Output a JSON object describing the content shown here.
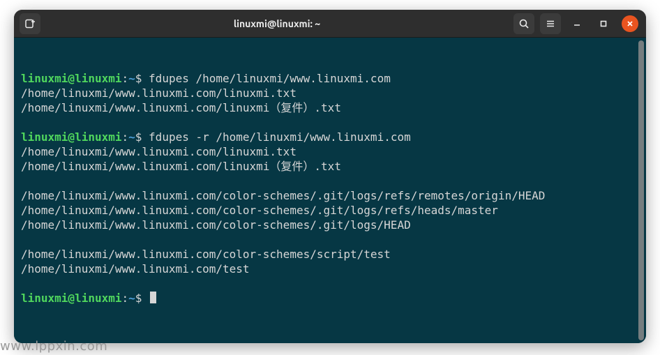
{
  "titlebar": {
    "title": "linuxmi@linuxmi: ~"
  },
  "prompt": {
    "user_host": "linuxmi@linuxmi",
    "colon": ":",
    "path": "~",
    "symbol": "$"
  },
  "sessions": [
    {
      "command": "fdupes /home/linuxmi/www.linuxmi.com",
      "output": [
        "/home/linuxmi/www.linuxmi.com/linuxmi.txt",
        "/home/linuxmi/www.linuxmi.com/linuxmi（复件）.txt"
      ]
    },
    {
      "command": "fdupes -r /home/linuxmi/www.linuxmi.com",
      "output": [
        "/home/linuxmi/www.linuxmi.com/linuxmi.txt",
        "/home/linuxmi/www.linuxmi.com/linuxmi（复件）.txt",
        "",
        "/home/linuxmi/www.linuxmi.com/color-schemes/.git/logs/refs/remotes/origin/HEAD",
        "/home/linuxmi/www.linuxmi.com/color-schemes/.git/logs/refs/heads/master",
        "/home/linuxmi/www.linuxmi.com/color-schemes/.git/logs/HEAD",
        "",
        "/home/linuxmi/www.linuxmi.com/color-schemes/script/test",
        "/home/linuxmi/www.linuxmi.com/test"
      ]
    }
  ],
  "watermark": "www.lppxin.com"
}
